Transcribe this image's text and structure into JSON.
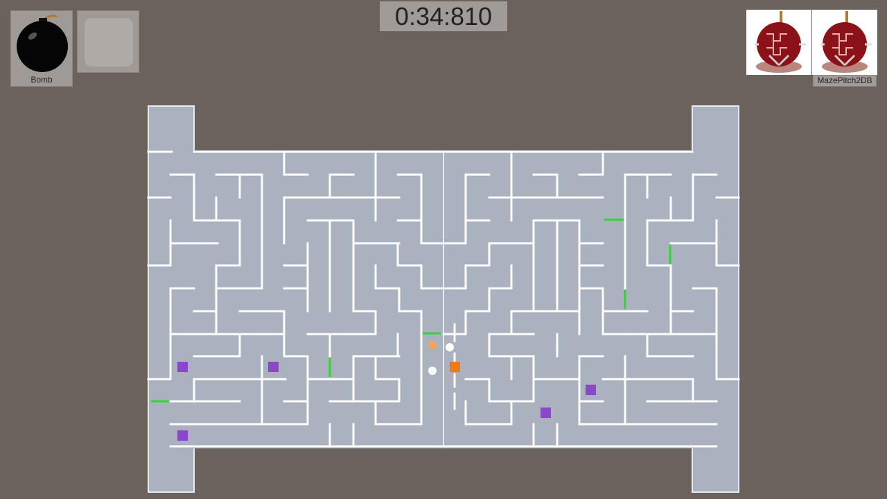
{
  "hud": {
    "timer": "0:34:810",
    "slot1_label": "Bomb",
    "map_label": "MazePitch2DB"
  },
  "colors": {
    "background": "#6b625c",
    "floor": "#a9b2be",
    "wall": "#ffffff",
    "gate": "#2fd62f",
    "pickup": "#8a48c8",
    "player_orange": "#f07a14",
    "player_peach": "#f4a55c"
  },
  "icons": [
    "bomb-icon",
    "ornament-icon"
  ]
}
